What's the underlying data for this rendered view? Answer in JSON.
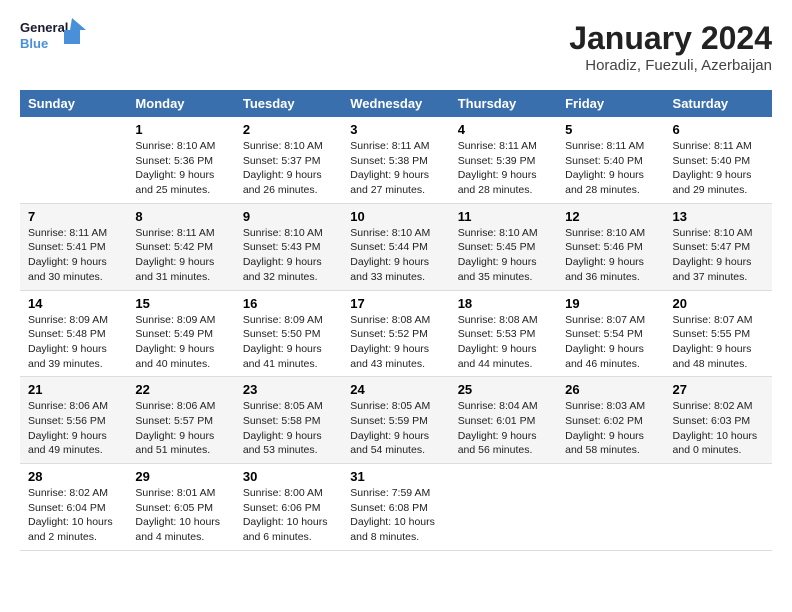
{
  "logo": {
    "line1": "General",
    "line2": "Blue"
  },
  "title": "January 2024",
  "subtitle": "Horadiz, Fuezuli, Azerbaijan",
  "headers": [
    "Sunday",
    "Monday",
    "Tuesday",
    "Wednesday",
    "Thursday",
    "Friday",
    "Saturday"
  ],
  "weeks": [
    [
      {
        "day": "",
        "sunrise": "",
        "sunset": "",
        "daylight": ""
      },
      {
        "day": "1",
        "sunrise": "Sunrise: 8:10 AM",
        "sunset": "Sunset: 5:36 PM",
        "daylight": "Daylight: 9 hours and 25 minutes."
      },
      {
        "day": "2",
        "sunrise": "Sunrise: 8:10 AM",
        "sunset": "Sunset: 5:37 PM",
        "daylight": "Daylight: 9 hours and 26 minutes."
      },
      {
        "day": "3",
        "sunrise": "Sunrise: 8:11 AM",
        "sunset": "Sunset: 5:38 PM",
        "daylight": "Daylight: 9 hours and 27 minutes."
      },
      {
        "day": "4",
        "sunrise": "Sunrise: 8:11 AM",
        "sunset": "Sunset: 5:39 PM",
        "daylight": "Daylight: 9 hours and 28 minutes."
      },
      {
        "day": "5",
        "sunrise": "Sunrise: 8:11 AM",
        "sunset": "Sunset: 5:40 PM",
        "daylight": "Daylight: 9 hours and 28 minutes."
      },
      {
        "day": "6",
        "sunrise": "Sunrise: 8:11 AM",
        "sunset": "Sunset: 5:40 PM",
        "daylight": "Daylight: 9 hours and 29 minutes."
      }
    ],
    [
      {
        "day": "7",
        "sunrise": "Sunrise: 8:11 AM",
        "sunset": "Sunset: 5:41 PM",
        "daylight": "Daylight: 9 hours and 30 minutes."
      },
      {
        "day": "8",
        "sunrise": "Sunrise: 8:11 AM",
        "sunset": "Sunset: 5:42 PM",
        "daylight": "Daylight: 9 hours and 31 minutes."
      },
      {
        "day": "9",
        "sunrise": "Sunrise: 8:10 AM",
        "sunset": "Sunset: 5:43 PM",
        "daylight": "Daylight: 9 hours and 32 minutes."
      },
      {
        "day": "10",
        "sunrise": "Sunrise: 8:10 AM",
        "sunset": "Sunset: 5:44 PM",
        "daylight": "Daylight: 9 hours and 33 minutes."
      },
      {
        "day": "11",
        "sunrise": "Sunrise: 8:10 AM",
        "sunset": "Sunset: 5:45 PM",
        "daylight": "Daylight: 9 hours and 35 minutes."
      },
      {
        "day": "12",
        "sunrise": "Sunrise: 8:10 AM",
        "sunset": "Sunset: 5:46 PM",
        "daylight": "Daylight: 9 hours and 36 minutes."
      },
      {
        "day": "13",
        "sunrise": "Sunrise: 8:10 AM",
        "sunset": "Sunset: 5:47 PM",
        "daylight": "Daylight: 9 hours and 37 minutes."
      }
    ],
    [
      {
        "day": "14",
        "sunrise": "Sunrise: 8:09 AM",
        "sunset": "Sunset: 5:48 PM",
        "daylight": "Daylight: 9 hours and 39 minutes."
      },
      {
        "day": "15",
        "sunrise": "Sunrise: 8:09 AM",
        "sunset": "Sunset: 5:49 PM",
        "daylight": "Daylight: 9 hours and 40 minutes."
      },
      {
        "day": "16",
        "sunrise": "Sunrise: 8:09 AM",
        "sunset": "Sunset: 5:50 PM",
        "daylight": "Daylight: 9 hours and 41 minutes."
      },
      {
        "day": "17",
        "sunrise": "Sunrise: 8:08 AM",
        "sunset": "Sunset: 5:52 PM",
        "daylight": "Daylight: 9 hours and 43 minutes."
      },
      {
        "day": "18",
        "sunrise": "Sunrise: 8:08 AM",
        "sunset": "Sunset: 5:53 PM",
        "daylight": "Daylight: 9 hours and 44 minutes."
      },
      {
        "day": "19",
        "sunrise": "Sunrise: 8:07 AM",
        "sunset": "Sunset: 5:54 PM",
        "daylight": "Daylight: 9 hours and 46 minutes."
      },
      {
        "day": "20",
        "sunrise": "Sunrise: 8:07 AM",
        "sunset": "Sunset: 5:55 PM",
        "daylight": "Daylight: 9 hours and 48 minutes."
      }
    ],
    [
      {
        "day": "21",
        "sunrise": "Sunrise: 8:06 AM",
        "sunset": "Sunset: 5:56 PM",
        "daylight": "Daylight: 9 hours and 49 minutes."
      },
      {
        "day": "22",
        "sunrise": "Sunrise: 8:06 AM",
        "sunset": "Sunset: 5:57 PM",
        "daylight": "Daylight: 9 hours and 51 minutes."
      },
      {
        "day": "23",
        "sunrise": "Sunrise: 8:05 AM",
        "sunset": "Sunset: 5:58 PM",
        "daylight": "Daylight: 9 hours and 53 minutes."
      },
      {
        "day": "24",
        "sunrise": "Sunrise: 8:05 AM",
        "sunset": "Sunset: 5:59 PM",
        "daylight": "Daylight: 9 hours and 54 minutes."
      },
      {
        "day": "25",
        "sunrise": "Sunrise: 8:04 AM",
        "sunset": "Sunset: 6:01 PM",
        "daylight": "Daylight: 9 hours and 56 minutes."
      },
      {
        "day": "26",
        "sunrise": "Sunrise: 8:03 AM",
        "sunset": "Sunset: 6:02 PM",
        "daylight": "Daylight: 9 hours and 58 minutes."
      },
      {
        "day": "27",
        "sunrise": "Sunrise: 8:02 AM",
        "sunset": "Sunset: 6:03 PM",
        "daylight": "Daylight: 10 hours and 0 minutes."
      }
    ],
    [
      {
        "day": "28",
        "sunrise": "Sunrise: 8:02 AM",
        "sunset": "Sunset: 6:04 PM",
        "daylight": "Daylight: 10 hours and 2 minutes."
      },
      {
        "day": "29",
        "sunrise": "Sunrise: 8:01 AM",
        "sunset": "Sunset: 6:05 PM",
        "daylight": "Daylight: 10 hours and 4 minutes."
      },
      {
        "day": "30",
        "sunrise": "Sunrise: 8:00 AM",
        "sunset": "Sunset: 6:06 PM",
        "daylight": "Daylight: 10 hours and 6 minutes."
      },
      {
        "day": "31",
        "sunrise": "Sunrise: 7:59 AM",
        "sunset": "Sunset: 6:08 PM",
        "daylight": "Daylight: 10 hours and 8 minutes."
      },
      {
        "day": "",
        "sunrise": "",
        "sunset": "",
        "daylight": ""
      },
      {
        "day": "",
        "sunrise": "",
        "sunset": "",
        "daylight": ""
      },
      {
        "day": "",
        "sunrise": "",
        "sunset": "",
        "daylight": ""
      }
    ]
  ]
}
